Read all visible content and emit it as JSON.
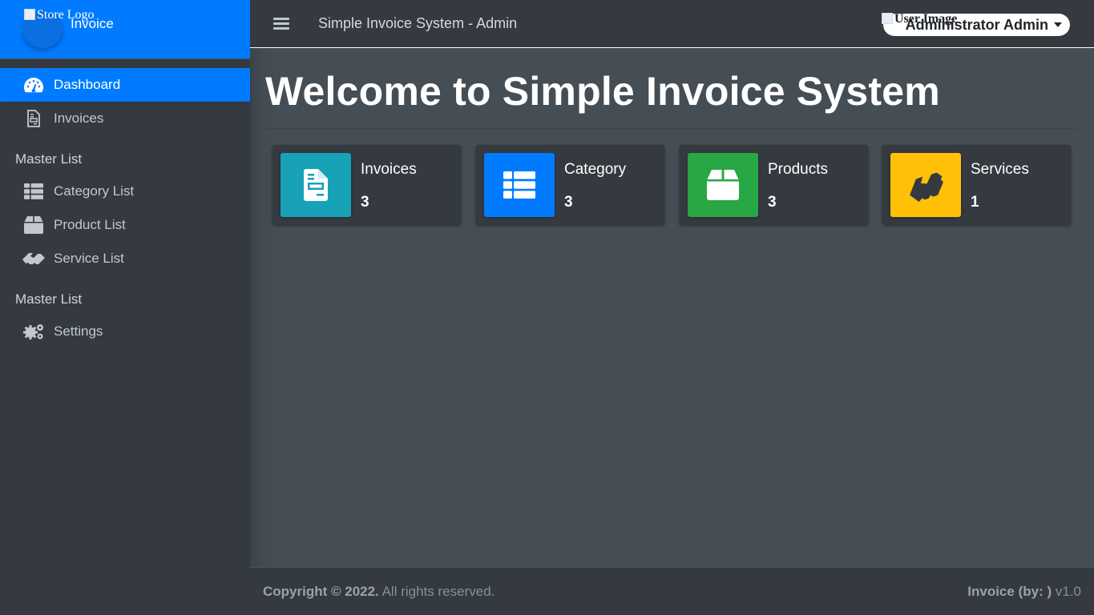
{
  "brand": {
    "logo_alt": "Store Logo",
    "name": "Invoice",
    "color": "#007bff"
  },
  "topbar": {
    "title": "Simple Invoice System - Admin",
    "user_image_alt": "User Image",
    "user_name": "Administrator Admin"
  },
  "sidebar": {
    "items": [
      {
        "label": "Dashboard",
        "icon": "tachometer-icon",
        "active": true
      },
      {
        "label": "Invoices",
        "icon": "file-invoice-icon"
      }
    ],
    "header1": "Master List",
    "master_items": [
      {
        "label": "Category List",
        "icon": "th-list-icon"
      },
      {
        "label": "Product List",
        "icon": "box-icon"
      },
      {
        "label": "Service List",
        "icon": "handshake-icon"
      }
    ],
    "header2": "Master List",
    "settings_items": [
      {
        "label": "Settings",
        "icon": "cogs-icon"
      }
    ]
  },
  "main": {
    "title": "Welcome to Simple Invoice System",
    "cards": [
      {
        "label": "Invoices",
        "count": "3",
        "color": "#17a2b8",
        "icon": "file-invoice-icon"
      },
      {
        "label": "Category",
        "count": "3",
        "color": "#007bff",
        "icon": "th-list-icon"
      },
      {
        "label": "Products",
        "count": "3",
        "color": "#28a745",
        "icon": "box-icon"
      },
      {
        "label": "Services",
        "count": "1",
        "color": "#ffc107",
        "icon": "handshake-icon"
      }
    ]
  },
  "footer": {
    "copyright_bold": "Copyright © 2022.",
    "copyright_rest": "All rights reserved.",
    "version_bold": "Invoice (by: )",
    "version": "v1.0"
  }
}
